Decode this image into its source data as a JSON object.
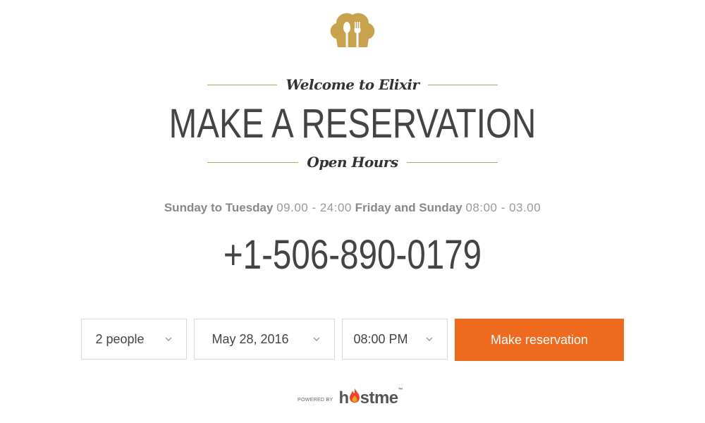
{
  "header": {
    "welcome": "Welcome to Elixir",
    "title": "MAKE A RESERVATION",
    "hours_heading": "Open Hours"
  },
  "hours": {
    "day1": "Sunday to Tuesday",
    "time1": "09.00 - 24:00",
    "day2": "Friday and Sunday",
    "time2": "08:00 - 03.00"
  },
  "phone": "+1-506-890-0179",
  "form": {
    "people": "2 people",
    "date": "May 28, 2016",
    "time": "08:00 PM",
    "submit": "Make reservation"
  },
  "footer": {
    "powered_by": "POWERED BY",
    "brand_prefix": "h",
    "brand_suffix": "stme",
    "trademark": "™"
  },
  "colors": {
    "accent": "#ee6a1f",
    "gold": "#b6a55c",
    "text": "#444444"
  },
  "icons": [
    "chef-hat-icon",
    "chevron-down-icon",
    "flame-icon"
  ]
}
